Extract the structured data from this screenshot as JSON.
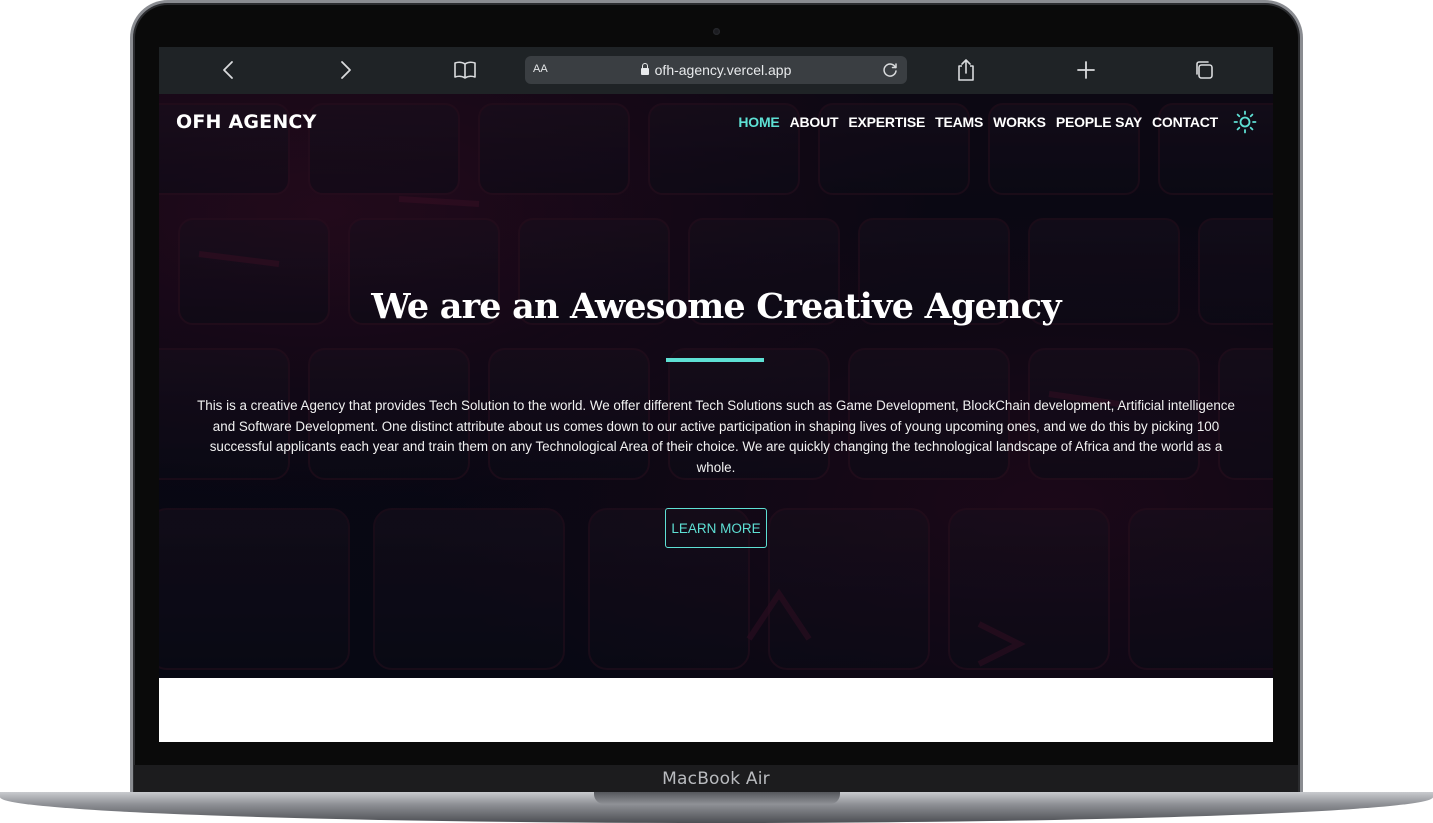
{
  "device": {
    "label": "MacBook Air"
  },
  "browser": {
    "text_size_label": "AA",
    "url": "ofh-agency.vercel.app",
    "icons": {
      "back": "chevron-left-icon",
      "forward": "chevron-right-icon",
      "bookmarks": "book-icon",
      "lock": "lock-icon",
      "reload": "reload-icon",
      "share": "share-icon",
      "new_tab": "plus-icon",
      "tabs": "tabs-icon"
    }
  },
  "site": {
    "brand": "OFH AGENCY",
    "nav": [
      {
        "label": "HOME",
        "active": true
      },
      {
        "label": "ABOUT",
        "active": false
      },
      {
        "label": "EXPERTISE",
        "active": false
      },
      {
        "label": "TEAMS",
        "active": false
      },
      {
        "label": "WORKS",
        "active": false
      },
      {
        "label": "PEOPLE SAY",
        "active": false
      },
      {
        "label": "CONTACT",
        "active": false
      }
    ],
    "theme_toggle_icon": "sun-icon",
    "accent_color": "#5ee0d4"
  },
  "hero": {
    "title": "We are an Awesome Creative Agency",
    "description": "This is a creative Agency that provides Tech Solution to the world. We offer different Tech Solutions such as Game Development, BlockChain development, Artificial intelligence and Software Development. One distinct attribute about us comes down to our active participation in shaping lives of young upcoming ones, and we do this by picking 100 successful applicants each year and train them on any Technological Area of their choice. We are quickly changing the technological landscape of Africa and the world as a whole.",
    "cta": "LEARN MORE"
  }
}
